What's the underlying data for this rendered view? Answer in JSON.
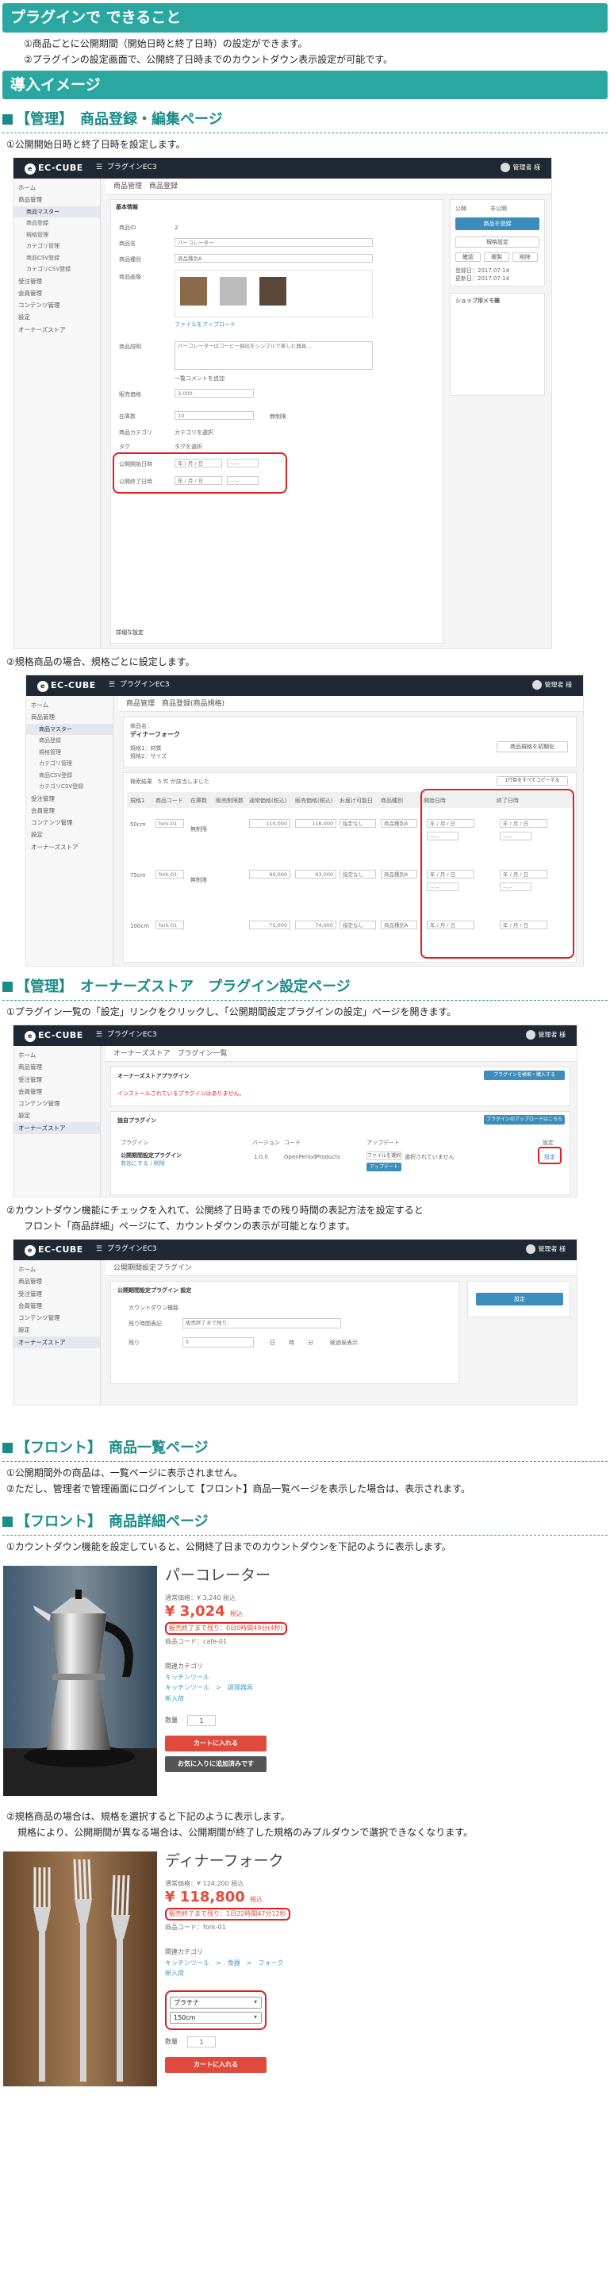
{
  "section1": {
    "title": "プラグインで できること",
    "notes": [
      "①商品ごとに公開期間（開始日時と終了日時）の設定ができます。",
      "②プラグインの設定画面で、公開終了日時までのカウントダウン表示設定が可能です。"
    ]
  },
  "section2": {
    "title": "導入イメージ"
  },
  "admin_edit": {
    "heading": "【管理】　商品登録・編集ページ",
    "note": "①公開開始日時と終了日時を設定します。",
    "app": {
      "logo": "EC-CUBE",
      "shop": "プラグインEC3",
      "user": "管理者 様"
    },
    "breadcrumb": "商品管理　商品登録",
    "sidebar": [
      "ホーム",
      "商品管理",
      "商品マスター",
      "商品登録",
      "規格管理",
      "カテゴリ管理",
      "商品CSV登録",
      "カテゴリCSV登録",
      "受注管理",
      "会員管理",
      "コンテンツ管理",
      "設定",
      "オーナーズストア"
    ],
    "form": {
      "title": "基本情報",
      "fields": [
        "商品ID",
        "商品名",
        "商品種別",
        "商品画像",
        "商品説明",
        "販売価格",
        "在庫数",
        "商品カテゴリ",
        "タグ",
        "公開開始日時",
        "公開終了日時"
      ],
      "id_value": "2",
      "name_value": "パーコレーター",
      "type_value": "商品種別A",
      "price_value": "3,000",
      "stock_value": "10",
      "date_placeholder": "年 / 月 / 日",
      "time_placeholder": "--:--",
      "image_label": "ファイルをアップロード",
      "desc_placeholder": "パーコレーターはコーヒー抽出をシンプルで楽しむ器具…",
      "add_label": "一覧コメントを追加",
      "unlimited_label": "無制限",
      "category_label": "カテゴリを選択",
      "tag_label": "タグを選択",
      "footer": "詳細な設定"
    },
    "right": {
      "public": "公開",
      "private": "非公開",
      "save": "商品を登録",
      "spec": "規格設定",
      "copy": "複製",
      "preview": "確認",
      "delete": "削除",
      "reg": "登録日：2017.07.14",
      "upd": "更新日：2017.07.14",
      "shop": "ショップ用メモ欄"
    }
  },
  "admin_class": {
    "note": "②規格商品の場合、規格ごとに設定します。",
    "breadcrumb": "商品管理　商品登録(商品規格)",
    "product_label": "商品名：",
    "product_name": "ディナーフォーク",
    "spec1": "規格1：材質",
    "spec2": "規格2：サイズ",
    "reset": "商品規格を初期化",
    "count": "検索結果　5 件 が該当しました",
    "bulk": "1行目をすべてコピーする",
    "cols": [
      "規格1",
      "商品コード",
      "在庫数",
      "販売制限数",
      "通常価格(税込)",
      "販売価格(税込)",
      "お届け可能日",
      "商品種別",
      "開始日時",
      "終了日時"
    ],
    "rows": [
      {
        "size": "50cm",
        "code": "fork-01",
        "price1": "110,000",
        "price2": "118,000"
      },
      {
        "size": "75cm",
        "code": "fork-01",
        "price1": "90,000",
        "price2": "93,000"
      },
      {
        "size": "100cm",
        "code": "fork-01",
        "price1": "75,000",
        "price2": "74,000"
      }
    ],
    "stock": "無制限",
    "delivery": "指定なし",
    "kind": "商品種別A",
    "date_placeholder": "年 / 月 / 日",
    "time_placeholder": "--:--"
  },
  "admin_plugin": {
    "heading": "【管理】　オーナーズストア　プラグイン設定ページ",
    "note": "①プラグイン一覧の「設定」リンクをクリックし、「公開期間設定プラグインの設定」ページを開きます。",
    "breadcrumb": "オーナーズストア　プラグイン一覧",
    "title": "オーナーズストアプラグイン",
    "store_btn": "プラグインを検索・購入する",
    "warn": "インストールされているプラグインはありません。",
    "own_title": "独自プラグイン",
    "upload_btn": "プラグインのアップロードはこちら",
    "cols": [
      "プラグイン",
      "バージョン",
      "コード",
      "アップデート",
      "設定"
    ],
    "name": "公開期間設定プラグイン",
    "status": "有効にする / 削除",
    "version": "1.0.0",
    "code": "OpenPeriodProducts",
    "file_btn": "ファイルを選択",
    "file_none": "選択されていません",
    "update_btn": "アップデート",
    "setting": "設定"
  },
  "admin_setting": {
    "note1": "②カウントダウン機能にチェックを入れて、公開終了日時までの残り時間の表記方法を設定すると",
    "note2": "フロント「商品詳細」ページにて、カウントダウンの表示が可能となります。",
    "breadcrumb": "公開期間設定プラグイン",
    "title": "公開期間設定プラグイン 設定",
    "check": "カウントダウン機能",
    "label_lbl": "残り時間表記",
    "label_val": "販売終了まで残り：",
    "unit_lbl": "残り",
    "unit_val": "5",
    "radios": [
      "日",
      "時",
      "分"
    ],
    "hint": "経過後表示",
    "save": "設定"
  },
  "front_list": {
    "heading": "【フロント】　商品一覧ページ",
    "notes": [
      "①公開期間外の商品は、一覧ページに表示されません。",
      "②ただし、管理者で管理画面にログインして【フロント】商品一覧ページを表示した場合は、表示されます。"
    ]
  },
  "front_detail": {
    "heading": "【フロント】　商品詳細ページ",
    "note": "①カウントダウン機能を設定していると、公開終了日までのカウントダウンを下記のように表示します。",
    "p1": {
      "name": "パーコレーター",
      "normal": "通常価格：¥ 3,240 税込",
      "price": "¥ 3,024",
      "tax": "税込",
      "countdown": "販売終了まで残り：0日0時間49分(4秒)",
      "code": "商品コード：cafe-01",
      "cat_label": "関連カテゴリ",
      "cats": [
        "キッチンツール",
        "キッチンツール　>　調理器具",
        "新入荷"
      ],
      "qty_label": "数量",
      "qty": "1",
      "cart": "カートに入れる",
      "fav": "お気に入りに追加済みです"
    },
    "note2": "②規格商品の場合は、規格を選択すると下記のように表示します。",
    "note3": "規格により、公開期間が異なる場合は、公開期間が終了した規格のみプルダウンで選択できなくなります。",
    "p2": {
      "name": "ディナーフォーク",
      "normal": "通常価格：¥ 124,200 税込",
      "price": "¥ 118,800",
      "tax": "税込",
      "countdown": "販売終了まで残り：1日22時間47分12秒",
      "code": "商品コード：fork-01",
      "cat_label": "関連カテゴリ",
      "cats": [
        "キッチンツール　>　食器　>　フォーク",
        "新入荷"
      ],
      "sel1": "プラチナ",
      "sel2": "150cm",
      "qty_label": "数量",
      "qty": "1",
      "cart": "カートに入れる"
    }
  },
  "colors": {
    "teal": "#2aa7a1",
    "red": "#e02020",
    "navy": "#1f2833",
    "price": "#e34c3b"
  }
}
